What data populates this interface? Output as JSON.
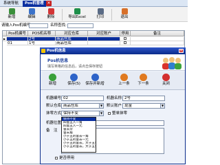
{
  "tabs": [
    {
      "label": "系统导航",
      "active": false
    },
    {
      "label": "Pos机管理",
      "active": true
    }
  ],
  "toolbar": {
    "new": "新增",
    "edit": "编辑",
    "delete": "删除",
    "export": "导出Excel",
    "print": "打印",
    "exit": "退出"
  },
  "filter": {
    "code_label": "请输入Pos机编号",
    "name_label": "名称查找:"
  },
  "grid": {
    "columns": [
      "Pos机编号",
      "POS机名称",
      "对应仓库",
      "对应账户",
      "停用",
      "备注"
    ],
    "rows": [
      {
        "pos_no": "",
        "name": "2号",
        "warehouse": "商品仓库",
        "account": "",
        "disabled": false,
        "note": ""
      },
      {
        "pos_no": "01",
        "name": "1号",
        "warehouse": "商品仓库",
        "account": "",
        "disabled": false,
        "note": ""
      }
    ]
  },
  "dialog": {
    "title": "Pos机信息",
    "header_title": "Pos机信息",
    "header_hint": "填写英格的信息后，请点击保存按钮",
    "buttons": {
      "new": "新增",
      "save": "保存(S)",
      "save_new": "保存并新增",
      "prev": "上一条",
      "next": "下一条",
      "close": "关闭"
    },
    "fields": {
      "code_label": "机器编号",
      "code_value": "02",
      "name_label": "机器名称",
      "name_value": "2号",
      "warehouse_label": "默认仓库",
      "warehouse_value": "商品仓库",
      "account_label": "默认账户",
      "account_value": "现金",
      "rounding_label": "抹零方式",
      "rounding_value": "保持不变",
      "round_change_label": "整单抹零",
      "location_label": "机器位置",
      "note_label": "备　注",
      "disabled_label": "是否停用"
    },
    "rounding_options": [
      "保持不变",
      "四舍五入一角",
      "四舍五入一元",
      "舍去分",
      "舍去角",
      "小于五的舍去一角",
      "小于五的舍去一元",
      "小于五的舍去，大于五舍去一角",
      "小于五的舍去，大于五舍去一元"
    ],
    "selected_rounding_index": 0
  }
}
